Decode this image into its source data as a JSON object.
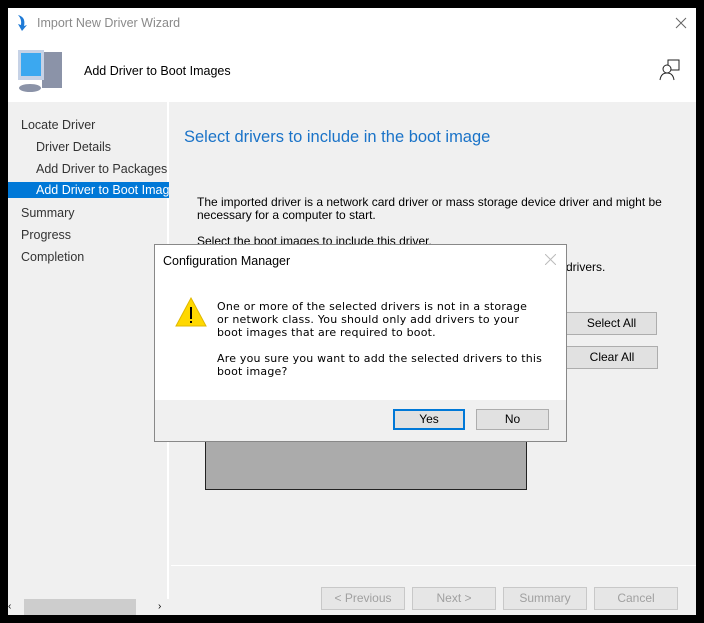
{
  "window": {
    "title": "Import New Driver Wizard",
    "header_title": "Add Driver to Boot Images"
  },
  "sidebar": {
    "items": [
      {
        "label": "Locate Driver",
        "indent": false,
        "selected": false
      },
      {
        "label": "Driver Details",
        "indent": true,
        "selected": false
      },
      {
        "label": "Add Driver to Packages",
        "indent": true,
        "selected": false
      },
      {
        "label": "Add Driver to Boot Images",
        "indent": true,
        "selected": true
      },
      {
        "label": "Summary",
        "indent": false,
        "selected": false
      },
      {
        "label": "Progress",
        "indent": false,
        "selected": false
      },
      {
        "label": "Completion",
        "indent": false,
        "selected": false
      }
    ]
  },
  "main": {
    "heading": "Select drivers to include in the boot image",
    "desc": "The imported driver is a network card driver or mass storage device driver and might be necessary for a computer to start.",
    "select_prompt": "Select the boot images to include this driver.",
    "partial_text": "drivers.",
    "select_all": "Select All",
    "clear_all": "Clear All"
  },
  "footer": {
    "previous": "< Previous",
    "next": "Next >",
    "summary": "Summary",
    "cancel": "Cancel"
  },
  "dialog": {
    "title": "Configuration Manager",
    "message1": "One or more of the selected drivers is not in a storage or network class. You should only add drivers to your boot images that are required to boot.",
    "message2": "Are you sure you want to add the selected drivers to this boot image?",
    "yes": "Yes",
    "no": "No",
    "icon": "warning-icon"
  },
  "colors": {
    "accent": "#0078d7",
    "heading": "#1a73c8",
    "warning": "#ffd800"
  }
}
